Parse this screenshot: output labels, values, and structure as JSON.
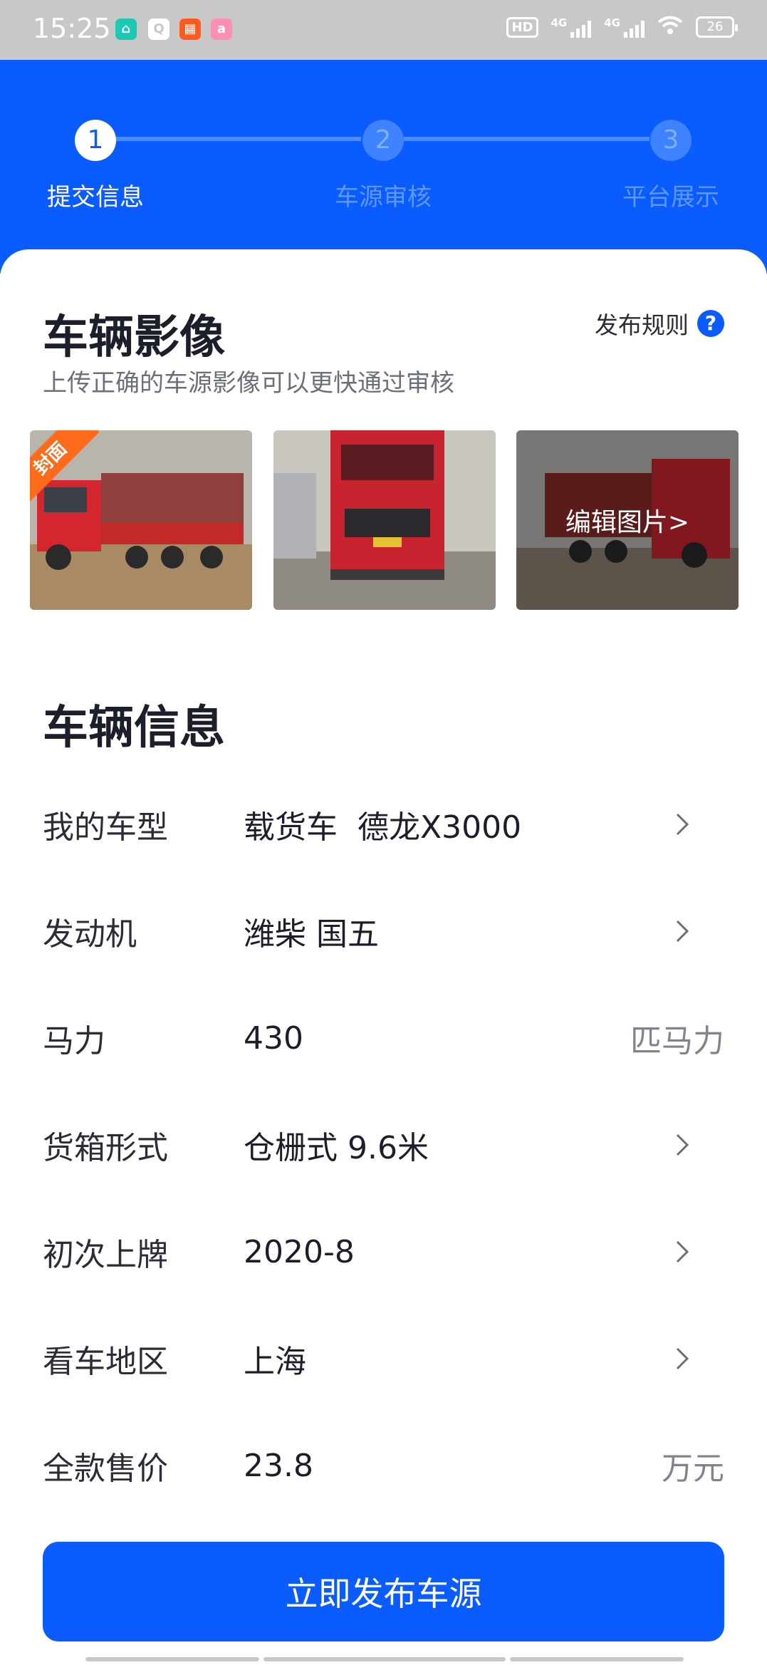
{
  "status_bar": {
    "time": "15:25",
    "hd": "HD",
    "network_1": "4G",
    "network_2": "4G",
    "battery": "26",
    "app_icons": [
      "home-app-icon",
      "search-app-icon",
      "grid-app-icon",
      "ai-app-icon"
    ]
  },
  "steps": [
    {
      "number": "1",
      "label": "提交信息",
      "active": true
    },
    {
      "number": "2",
      "label": "车源审核",
      "active": false
    },
    {
      "number": "3",
      "label": "平台展示",
      "active": false
    }
  ],
  "media": {
    "title": "车辆影像",
    "rules_link": "发布规则",
    "subtitle": "上传正确的车源影像可以更快通过审核",
    "cover_badge": "封面",
    "edit_photos": "编辑图片>"
  },
  "vehicle": {
    "title": "车辆信息",
    "rows": [
      {
        "label": "我的车型",
        "value": "载货车  德龙X3000",
        "unit": "",
        "chevron": true
      },
      {
        "label": "发动机",
        "value": "潍柴 国五",
        "unit": "",
        "chevron": true
      },
      {
        "label": "马力",
        "value": "430",
        "unit": "匹马力",
        "chevron": false
      },
      {
        "label": "货箱形式",
        "value": "仓栅式 9.6米",
        "unit": "",
        "chevron": true
      },
      {
        "label": "初次上牌",
        "value": "2020-8",
        "unit": "",
        "chevron": true
      },
      {
        "label": "看车地区",
        "value": "上海",
        "unit": "",
        "chevron": true
      },
      {
        "label": "全款售价",
        "value": "23.8",
        "unit": "万元",
        "chevron": false
      }
    ]
  },
  "publish_button": "立即发布车源",
  "colors": {
    "primary": "#0b5cff",
    "badge": "#ff6b1a",
    "status_bar": "#c8c8c8"
  }
}
